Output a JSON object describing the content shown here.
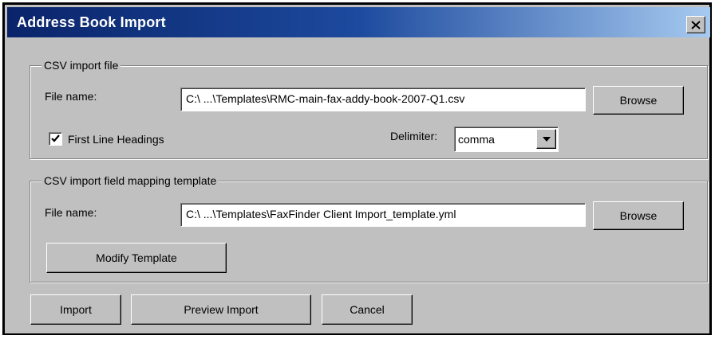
{
  "window": {
    "title": "Address Book Import"
  },
  "csv_import": {
    "legend": "CSV import file",
    "file_label": "File name:",
    "file_value": "C:\\ ...\\Templates\\RMC-main-fax-addy-book-2007-Q1.csv",
    "browse_label": "Browse",
    "first_line_label": "First Line Headings",
    "first_line_checked": true,
    "delimiter_label": "Delimiter:",
    "delimiter_value": "comma"
  },
  "mapping": {
    "legend": "CSV import field mapping template",
    "file_label": "File name:",
    "file_value": "C:\\ ...\\Templates\\FaxFinder Client Import_template.yml",
    "browse_label": "Browse",
    "modify_label": "Modify Template"
  },
  "actions": {
    "import_label": "Import",
    "preview_label": "Preview Import",
    "cancel_label": "Cancel"
  },
  "icons": {
    "close": "close-icon",
    "check": "check-icon",
    "dropdown": "chevron-down-icon"
  }
}
